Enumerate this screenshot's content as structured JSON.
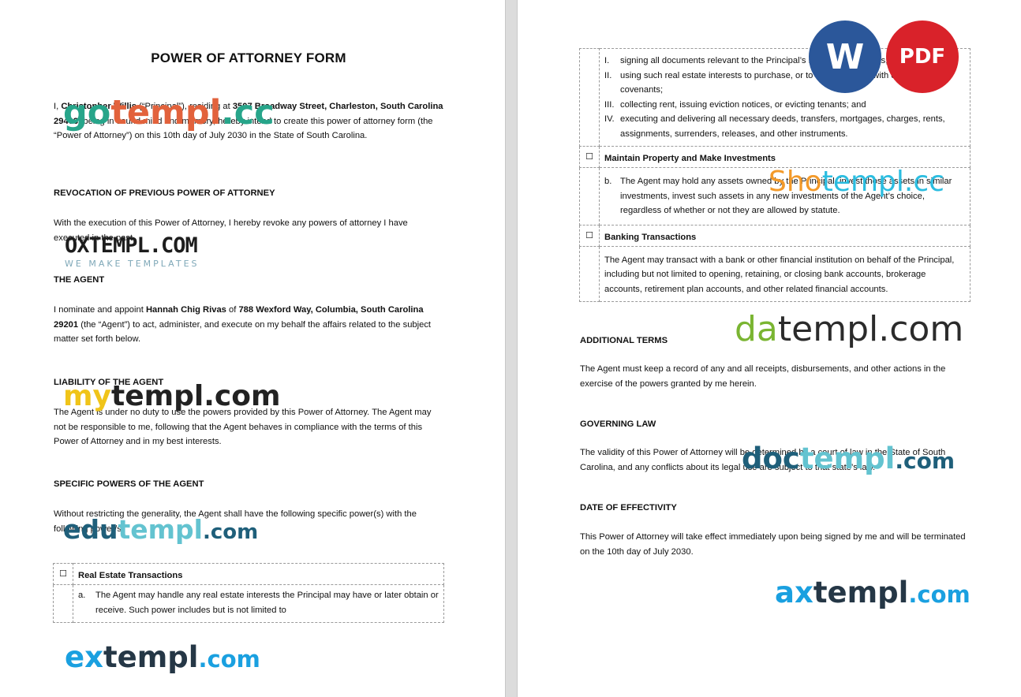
{
  "document": {
    "title": "POWER OF ATTORNEY FORM",
    "intro": {
      "pre": "I, ",
      "name": "Christopher Willis",
      "mid": " (“Principal”), residing at ",
      "address": "3507 Broadway Street, Charleston, South Carolina 29403",
      "post": ", being in sound mind and memory, hereby intend to create this power of attorney form (the “Power of Attorney”) on this 10th day of July 2030 in the State of South Carolina."
    },
    "revocation": {
      "heading": "REVOCATION OF PREVIOUS POWER OF ATTORNEY",
      "text": "With the execution of this Power of Attorney, I hereby revoke any powers of attorney I have executed in the past."
    },
    "agent": {
      "heading": "THE AGENT",
      "pre": "I nominate and appoint ",
      "name": "Hannah Chig Rivas",
      "mid": " of ",
      "address": "788 Wexford Way, Columbia, South Carolina 29201",
      "post": " (the “Agent”) to act, administer, and execute on my behalf the affairs related to the subject matter set forth below."
    },
    "liability": {
      "heading": "LIABILITY OF THE AGENT",
      "text": "The Agent is under no duty to use the powers provided by this Power of Attorney. The Agent may not be responsible to me, following that the Agent behaves in compliance with the terms of this Power of Attorney and in my best interests."
    },
    "specific_powers": {
      "heading": "SPECIFIC POWERS OF THE AGENT",
      "text": "Without restricting the generality, the Agent shall have the following specific power(s) with the following power/s:"
    },
    "checkbox_glyph": "☐",
    "real_estate": {
      "title": "Real Estate Transactions",
      "letter": "a.",
      "text": "The Agent may handle any real estate interests the Principal may have or later obtain or receive. Such power includes but is not limited to",
      "items": [
        {
          "num": "I.",
          "text": "signing all documents relevant to the Principal’s real estate interests;"
        },
        {
          "num": "II.",
          "text": "using such real estate interests to purchase, or to take loans on, with or without covenants;"
        },
        {
          "num": "III.",
          "text": "collecting rent, issuing eviction notices, or evicting tenants; and"
        },
        {
          "num": "IV.",
          "text": "executing and delivering all necessary deeds, transfers, mortgages, charges, rents, assignments, surrenders, releases, and other instruments."
        }
      ]
    },
    "maintain_property": {
      "title": "Maintain Property and Make Investments",
      "letter": "b.",
      "text": "The Agent may hold any assets owned by the Principal, invest those assets in similar investments, invest such assets in any new investments of the Agent’s choice, regardless of whether or not they are allowed by statute."
    },
    "banking": {
      "title": "Banking Transactions",
      "text": "The Agent may transact with a bank or other financial institution on behalf of the Principal, including but not limited to opening, retaining, or closing bank accounts, brokerage accounts, retirement plan accounts, and other related financial accounts."
    },
    "additional_terms": {
      "heading": "ADDITIONAL TERMS",
      "text": "The Agent must keep a record of any and all receipts, disbursements, and other actions in the exercise of the powers granted by me herein."
    },
    "governing_law": {
      "heading": "GOVERNING LAW",
      "text": "The validity of this Power of Attorney will be determined by a court of law in the State of South Carolina, and any conflicts about its legal use are subject to that state’s law."
    },
    "effectivity": {
      "heading": "DATE OF EFFECTIVITY",
      "text": "This Power of Attorney will take effect immediately upon being signed by me and will be terminated on the 10th day of July 2030."
    }
  },
  "badges": {
    "word": "W",
    "pdf": "PDF",
    "word_color": "#2b579a",
    "pdf_color": "#d9222a"
  },
  "watermarks": {
    "gotempl": {
      "a": "go",
      "b": "templ",
      "c": ".cc"
    },
    "oxtempl": {
      "main": "OXTEMPL.COM",
      "sub": "WE MAKE TEMPLATES"
    },
    "mytempl": {
      "a": "my",
      "b": "templ.com"
    },
    "edutempl": {
      "a": "edu",
      "b": "templ",
      "c": ".com"
    },
    "extempl": {
      "a": "ex",
      "b": "templ",
      "c": ".com"
    },
    "shotempl": {
      "a": "Sho",
      "b": "templ.cc"
    },
    "datempl": {
      "a": "da",
      "b": "templ.com"
    },
    "doctempl": {
      "a": "doc",
      "b": "templ",
      "c": ".com"
    },
    "axtempl": {
      "a": "ax",
      "b": "templ",
      "c": ".com"
    }
  }
}
